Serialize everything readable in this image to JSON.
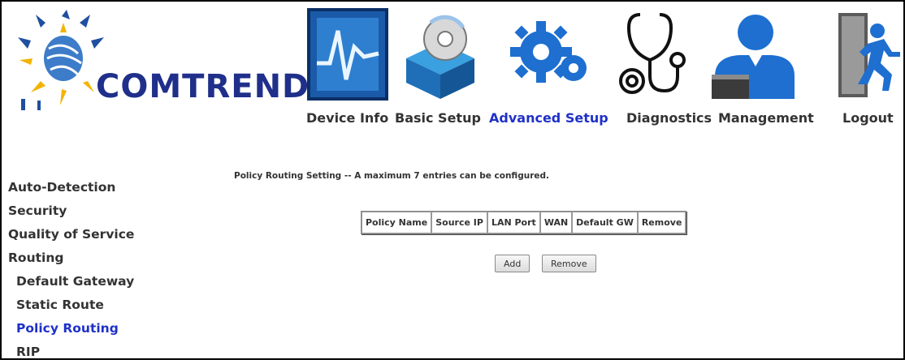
{
  "brand": {
    "name": "COMTREND"
  },
  "nav": {
    "items": [
      {
        "id": "device-info",
        "label": "Device Info"
      },
      {
        "id": "basic-setup",
        "label": "Basic Setup"
      },
      {
        "id": "advanced-setup",
        "label": "Advanced Setup",
        "active": true
      },
      {
        "id": "diagnostics",
        "label": "Diagnostics"
      },
      {
        "id": "management",
        "label": "Management"
      },
      {
        "id": "logout",
        "label": "Logout"
      }
    ],
    "active_color": "#1f31c8"
  },
  "sidebar": {
    "items": [
      {
        "label": "Auto-Detection"
      },
      {
        "label": "Security"
      },
      {
        "label": "Quality of Service"
      },
      {
        "label": "Routing"
      },
      {
        "label": "Default Gateway",
        "sub": true
      },
      {
        "label": "Static Route",
        "sub": true
      },
      {
        "label": "Policy Routing",
        "sub": true,
        "active": true
      },
      {
        "label": "RIP",
        "sub": true
      }
    ]
  },
  "main": {
    "heading": "Policy Routing Setting -- A maximum 7 entries can be configured.",
    "table": {
      "columns": [
        "Policy Name",
        "Source IP",
        "LAN Port",
        "WAN",
        "Default GW",
        "Remove"
      ],
      "rows": []
    },
    "buttons": {
      "add": "Add",
      "remove": "Remove"
    }
  }
}
